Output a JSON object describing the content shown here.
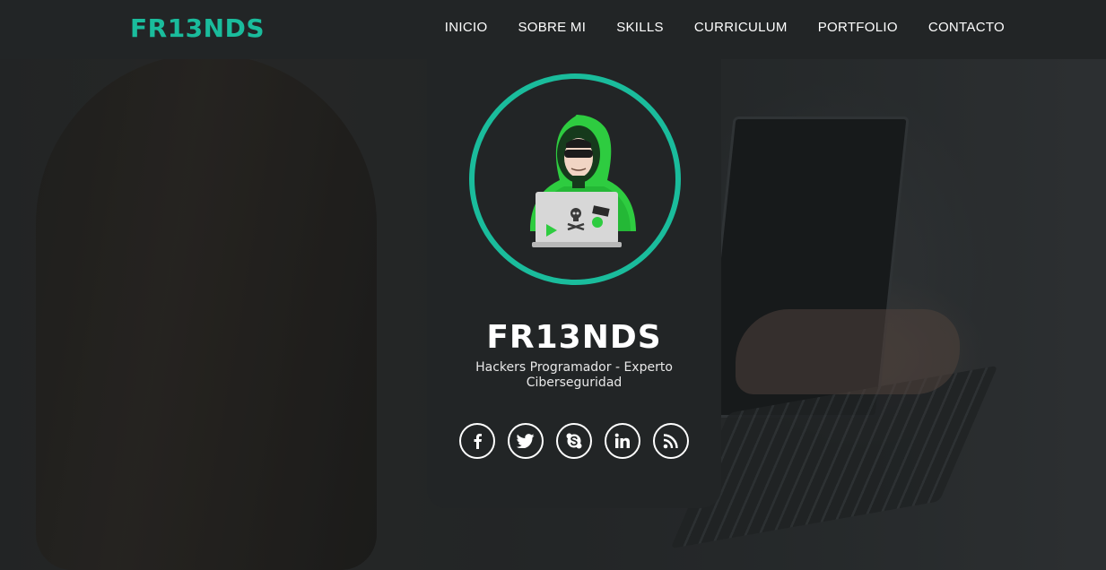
{
  "brand": {
    "name": "FR13NDS",
    "color": "#1abc9c"
  },
  "nav": {
    "items": [
      {
        "label": "INICIO"
      },
      {
        "label": "SOBRE MI"
      },
      {
        "label": "SKILLS"
      },
      {
        "label": "CURRICULUM"
      },
      {
        "label": "PORTFOLIO"
      },
      {
        "label": "CONTACTO"
      }
    ]
  },
  "profile": {
    "avatar_icon": "hacker-avatar-icon",
    "name": "FR13NDS",
    "subtitle": "Hackers Programador - Experto Ciberseguridad"
  },
  "socials": [
    {
      "icon": "facebook-icon"
    },
    {
      "icon": "twitter-icon"
    },
    {
      "icon": "skype-icon"
    },
    {
      "icon": "linkedin-icon"
    },
    {
      "icon": "rss-icon"
    }
  ],
  "colors": {
    "accent": "#1abc9c",
    "navbar_bg": "#222526",
    "card_bg": "#222526",
    "text": "#ffffff"
  }
}
